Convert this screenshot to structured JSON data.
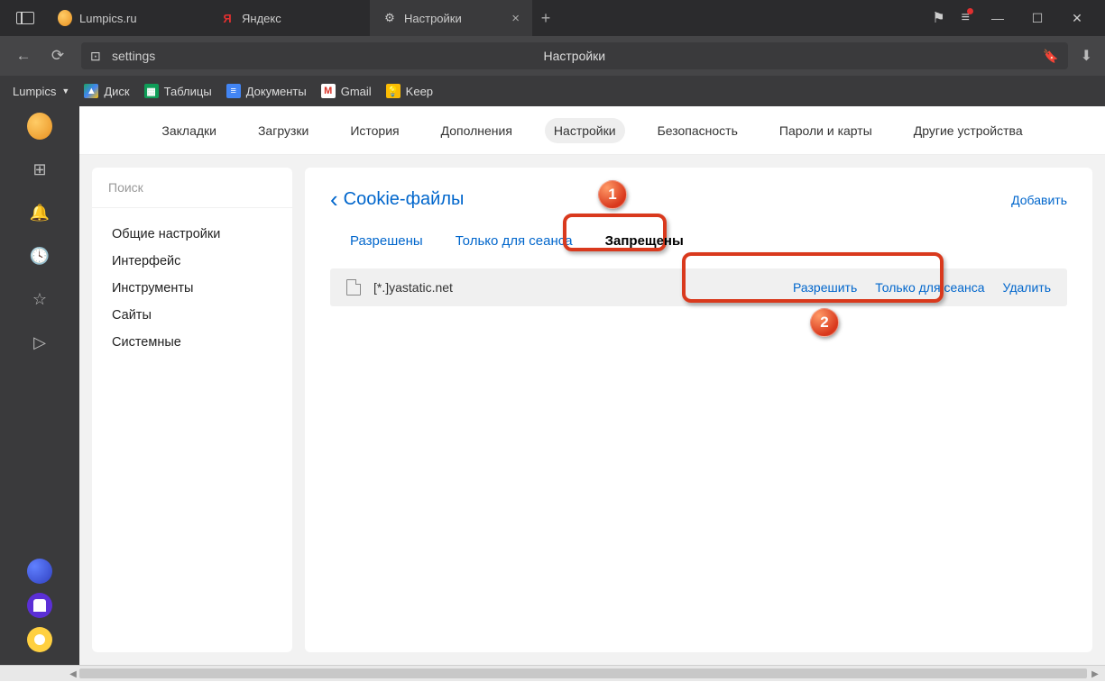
{
  "titlebar": {
    "tabs": [
      {
        "label": "Lumpics.ru"
      },
      {
        "label": "Яндекс"
      },
      {
        "label": "Настройки"
      }
    ]
  },
  "addressbar": {
    "url_text": "settings",
    "page_title": "Настройки"
  },
  "bookmarkbar": {
    "items": [
      {
        "label": "Lumpics"
      },
      {
        "label": "Диск"
      },
      {
        "label": "Таблицы"
      },
      {
        "label": "Документы"
      },
      {
        "label": "Gmail"
      },
      {
        "label": "Keep"
      }
    ]
  },
  "top_nav": {
    "items": [
      "Закладки",
      "Загрузки",
      "История",
      "Дополнения",
      "Настройки",
      "Безопасность",
      "Пароли и карты",
      "Другие устройства"
    ],
    "active_index": 4
  },
  "left_panel": {
    "search_placeholder": "Поиск",
    "items": [
      "Общие настройки",
      "Интерфейс",
      "Инструменты",
      "Сайты",
      "Системные"
    ]
  },
  "right_panel": {
    "back_label": "Cookie-файлы",
    "add_label": "Добавить",
    "sub_tabs": [
      "Разрешены",
      "Только для сеанса",
      "Запрещены"
    ],
    "active_sub_tab": 2,
    "site": "[*.]yastatic.net",
    "actions": [
      "Разрешить",
      "Только для сеанса",
      "Удалить"
    ]
  },
  "callouts": {
    "badge1": "1",
    "badge2": "2"
  }
}
